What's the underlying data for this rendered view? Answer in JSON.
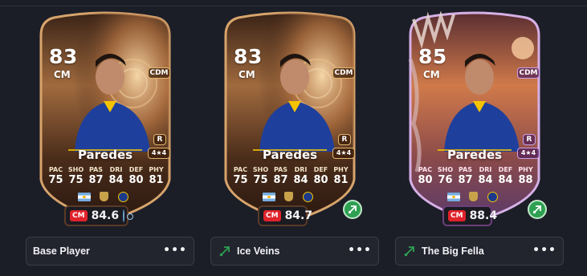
{
  "cards": [
    {
      "rating": "83",
      "position": "CM",
      "alt_position": "CDM",
      "preferred_foot": "R",
      "skill_weak": "4★4",
      "name": "Paredes",
      "stat_labels": [
        "PAC",
        "SHO",
        "PAS",
        "DRI",
        "DEF",
        "PHY"
      ],
      "stat_values": [
        "75",
        "75",
        "87",
        "84",
        "80",
        "81"
      ],
      "chem_tag": "CM",
      "chem_rating": "84.6",
      "footer_label": "Base Player",
      "colors": {
        "frame": "#b98a5a",
        "bg_top": "#2b1a12",
        "bg_mid": "#8c5a34",
        "bg_bottom": "#3a2416"
      }
    },
    {
      "rating": "83",
      "position": "CM",
      "alt_position": "CDM",
      "preferred_foot": "R",
      "skill_weak": "4★4",
      "name": "Paredes",
      "stat_labels": [
        "PAC",
        "SHO",
        "PAS",
        "DRI",
        "DEF",
        "PHY"
      ],
      "stat_values": [
        "75",
        "75",
        "87",
        "84",
        "80",
        "81"
      ],
      "chem_tag": "CM",
      "chem_rating": "84.7",
      "footer_label": "Ice Veins",
      "colors": {
        "frame": "#b98a5a",
        "bg_top": "#2b1a12",
        "bg_mid": "#8c5a34",
        "bg_bottom": "#3a2416"
      }
    },
    {
      "rating": "85",
      "position": "CM",
      "alt_position": "CDM",
      "preferred_foot": "R",
      "skill_weak": "4★4",
      "name": "Paredes",
      "stat_labels": [
        "PAC",
        "SHO",
        "PAS",
        "DRI",
        "DEF",
        "PHY"
      ],
      "stat_values": [
        "80",
        "76",
        "87",
        "84",
        "84",
        "88"
      ],
      "chem_tag": "CM",
      "chem_rating": "88.4",
      "footer_label": "The Big Fella",
      "colors": {
        "frame": "#c4a0d8",
        "bg_top": "#6a3a3a",
        "bg_mid": "#c66a45",
        "bg_bottom": "#4a2a5a"
      }
    }
  ],
  "icons": {
    "more": "more-options-icon",
    "playstyle": "playstyle-icon",
    "globe": "base-chemistry-icon"
  },
  "accent": "#2ea052",
  "background": "#1c1e27"
}
